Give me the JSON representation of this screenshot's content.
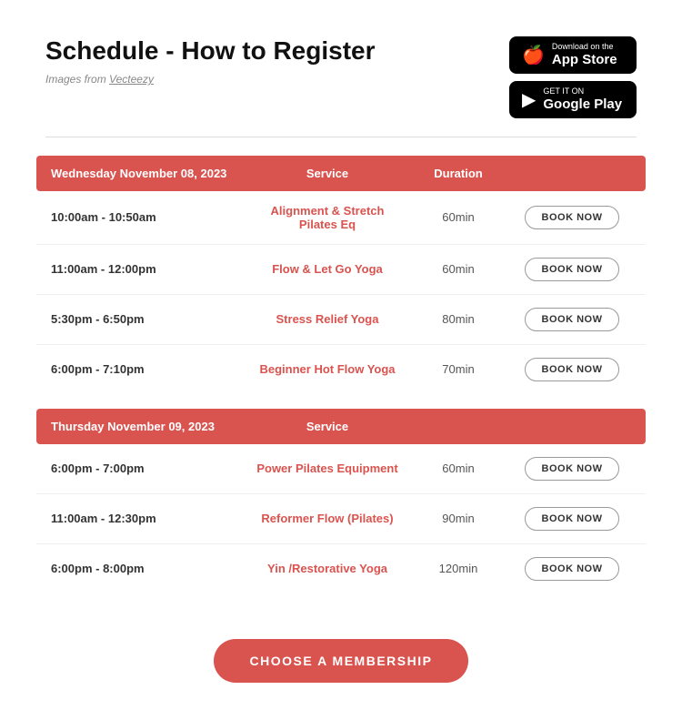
{
  "header": {
    "title": "Schedule - How to Register",
    "attribution_prefix": "Images from ",
    "attribution_link_text": "Vecteezy",
    "appstore": {
      "pre_label": "Download on the",
      "main_label": "App Store",
      "icon": "🍎"
    },
    "googleplay": {
      "pre_label": "GET IT ON",
      "main_label": "Google Play",
      "icon": "▶"
    }
  },
  "schedule": {
    "days": [
      {
        "date": "Wednesday November 08, 2023",
        "col_service": "Service",
        "col_duration": "Duration",
        "classes": [
          {
            "time": "10:00am - 10:50am",
            "service": "Alignment & Stretch Pilates Eq",
            "duration": "60min",
            "book_label": "BOOK NOW"
          },
          {
            "time": "11:00am - 12:00pm",
            "service": "Flow & Let Go Yoga",
            "duration": "60min",
            "book_label": "BOOK NOW"
          },
          {
            "time": "5:30pm - 6:50pm",
            "service": "Stress Relief Yoga",
            "duration": "80min",
            "book_label": "BOOK NOW"
          },
          {
            "time": "6:00pm - 7:10pm",
            "service": "Beginner Hot Flow Yoga",
            "duration": "70min",
            "book_label": "BOOK NOW"
          }
        ]
      },
      {
        "date": "Thursday November 09, 2023",
        "col_service": "Service",
        "col_duration": "",
        "classes": [
          {
            "time": "6:00pm - 7:00pm",
            "service": "Power Pilates Equipment",
            "duration": "60min",
            "book_label": "BOOK NOW"
          },
          {
            "time": "11:00am - 12:30pm",
            "service": "Reformer Flow (Pilates)",
            "duration": "90min",
            "book_label": "BOOK NOW"
          },
          {
            "time": "6:00pm - 8:00pm",
            "service": "Yin /Restorative Yoga",
            "duration": "120min",
            "book_label": "BOOK NOW"
          }
        ]
      }
    ]
  },
  "cta": {
    "label": "CHOOSE A MEMBERSHIP"
  },
  "colors": {
    "accent": "#d9534f",
    "text_dark": "#111",
    "text_service": "#d9534f"
  }
}
